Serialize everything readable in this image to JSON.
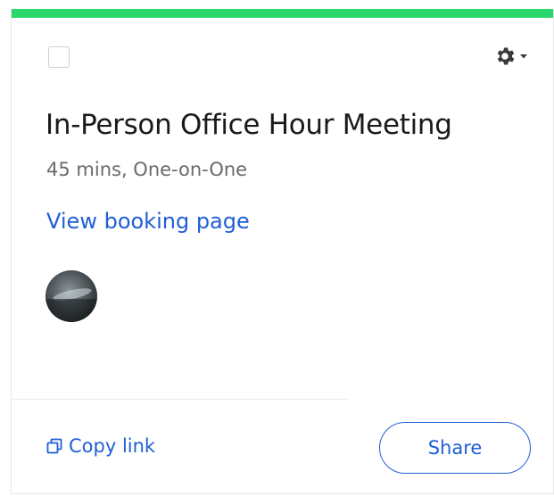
{
  "card": {
    "accent_color": "#2bd66c",
    "title": "In-Person Office Hour Meeting",
    "subtitle": "45 mins, One-on-One",
    "booking_link_label": "View booking page",
    "gear_icon": "gear-icon",
    "copy_icon": "copy-icon"
  },
  "actions": {
    "copy_link_label": "Copy link",
    "share_label": "Share"
  },
  "colors": {
    "link": "#1f5fd6",
    "title": "#1a1a1a",
    "subtitle": "#6a6a6a"
  }
}
